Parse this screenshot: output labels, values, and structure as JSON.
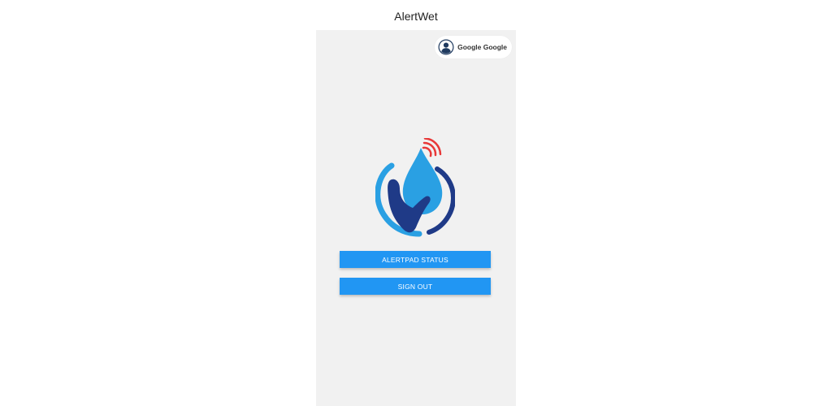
{
  "app": {
    "title": "AlertWet"
  },
  "account": {
    "name": "Google Google",
    "avatar_icon": "account-circle-icon"
  },
  "logo": {
    "icon": "water-drop-hand-wifi-logo",
    "colors": {
      "drop": "#2aa0e3",
      "ring": "#2aa0e3",
      "hand": "#1f3a87",
      "signal": "#e83838"
    }
  },
  "buttons": {
    "status_label": "ALERTPAD STATUS",
    "signout_label": "SIGN OUT"
  },
  "colors": {
    "accent": "#2196f3",
    "background": "#f1f1f1"
  }
}
